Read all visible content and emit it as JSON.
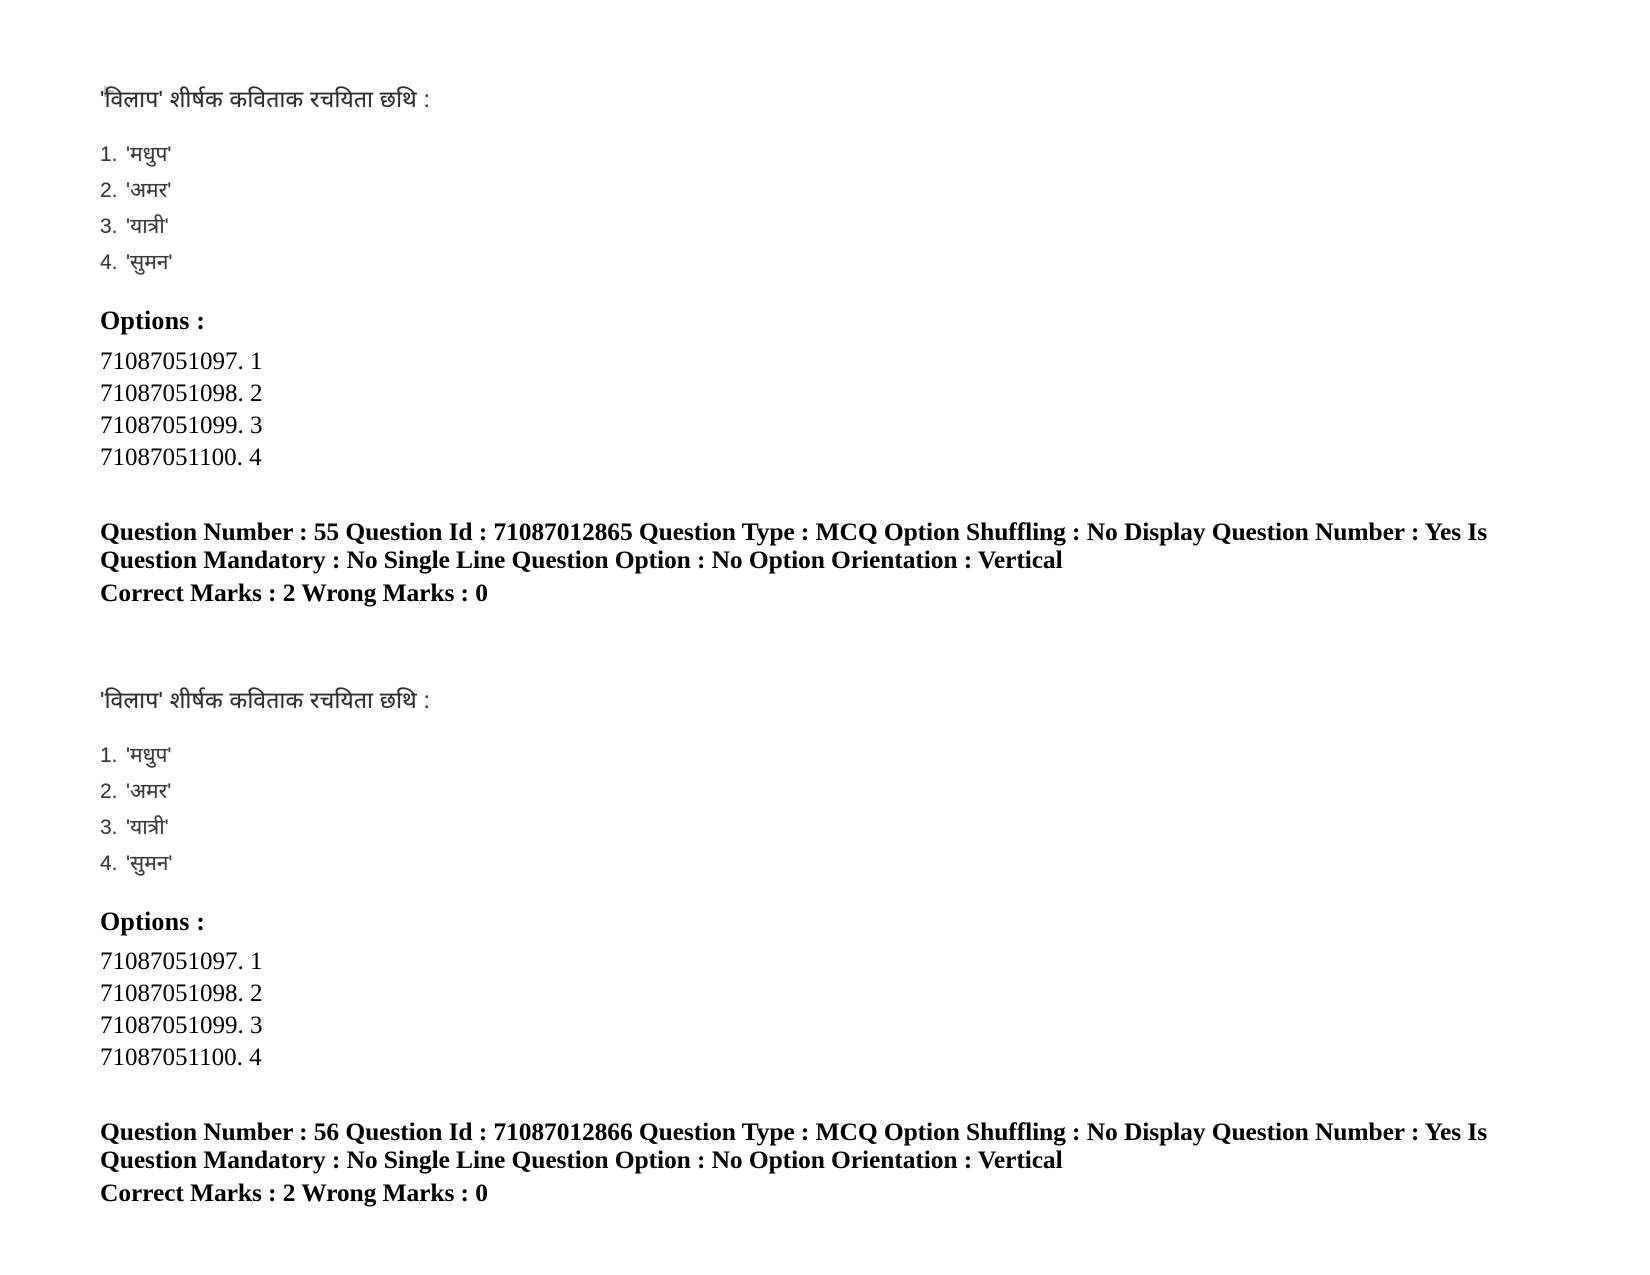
{
  "document": {
    "type": "exam-question-paper-scan",
    "page_background": "#ffffff",
    "text_color": "#000000"
  },
  "blocks": [
    {
      "stem": "'विलाप' शीर्षक कविताक रचयिता छथि :",
      "choices": [
        {
          "num": "1.",
          "text": "'मधुप'"
        },
        {
          "num": "2.",
          "text": "'अमर'"
        },
        {
          "num": "3.",
          "text": "'यात्री'"
        },
        {
          "num": "4.",
          "text": "'सुमन'"
        }
      ],
      "options_label": "Options :",
      "options": [
        {
          "id": "71087051097.",
          "value": "1"
        },
        {
          "id": "71087051098.",
          "value": "2"
        },
        {
          "id": "71087051099.",
          "value": "3"
        },
        {
          "id": "71087051100.",
          "value": "4"
        }
      ]
    },
    {
      "stem": "'विलाप' शीर्षक कविताक रचयिता छथि :",
      "choices": [
        {
          "num": "1.",
          "text": "'मधुप'"
        },
        {
          "num": "2.",
          "text": "'अमर'"
        },
        {
          "num": "3.",
          "text": "'यात्री'"
        },
        {
          "num": "4.",
          "text": "'सुमन'"
        }
      ],
      "options_label": "Options :",
      "options": [
        {
          "id": "71087051097.",
          "value": "1"
        },
        {
          "id": "71087051098.",
          "value": "2"
        },
        {
          "id": "71087051099.",
          "value": "3"
        },
        {
          "id": "71087051100.",
          "value": "4"
        }
      ]
    }
  ],
  "meta": [
    {
      "line1": "Question Number : 55 Question Id : 71087012865 Question Type : MCQ Option Shuffling : No Display Question Number : Yes Is Question Mandatory : No Single Line Question Option : No Option Orientation : Vertical",
      "line2": "Correct Marks : 2 Wrong Marks : 0"
    },
    {
      "line1": "Question Number : 56 Question Id : 71087012866 Question Type : MCQ Option Shuffling : No Display Question Number : Yes Is Question Mandatory : No Single Line Question Option : No Option Orientation : Vertical",
      "line2": "Correct Marks : 2 Wrong Marks : 0"
    }
  ]
}
